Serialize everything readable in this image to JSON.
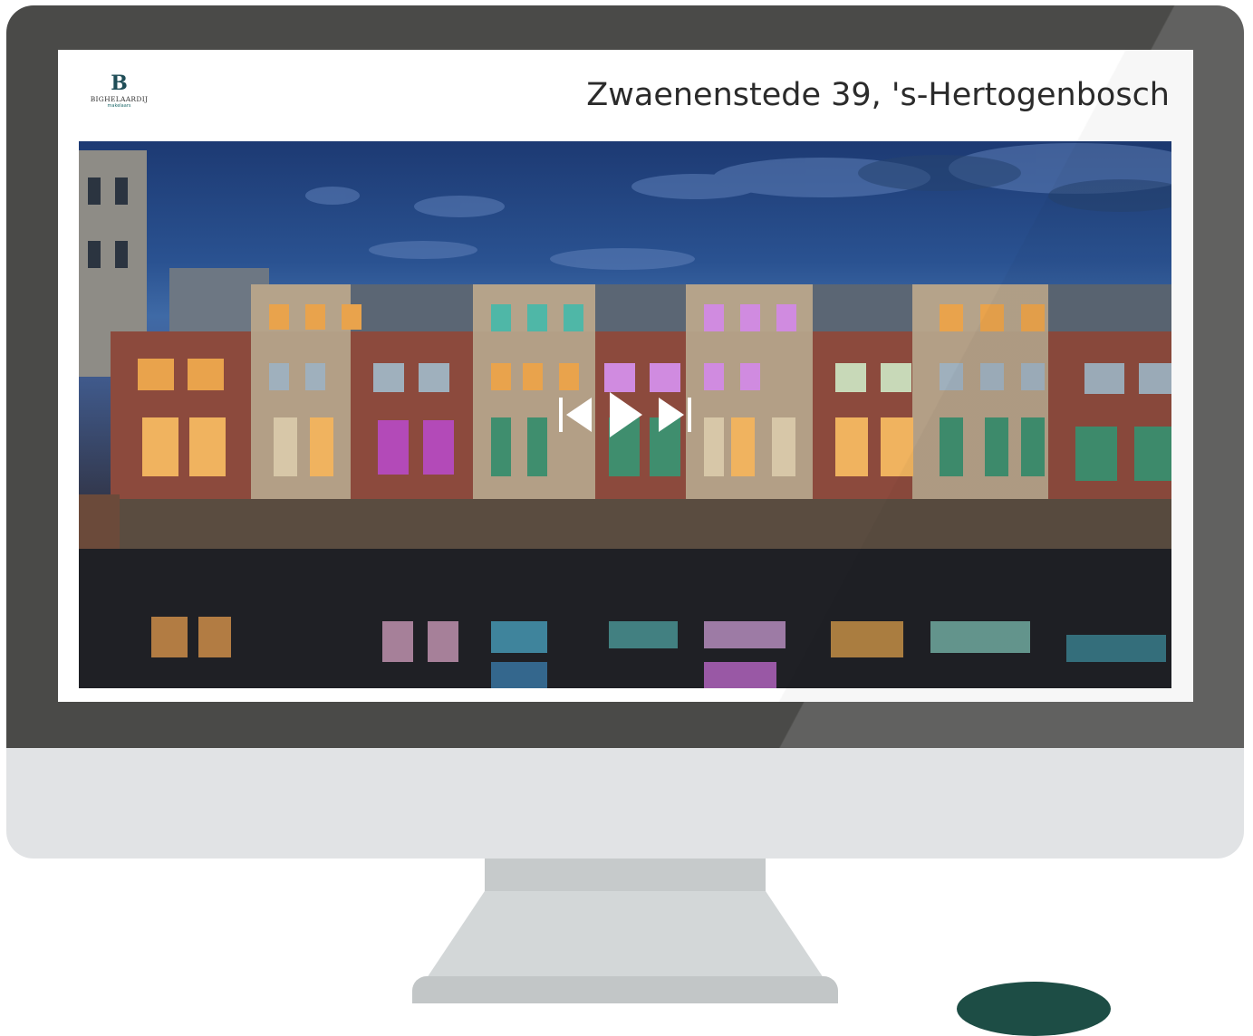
{
  "logo": {
    "letter": "B",
    "name": "BIGHELAARDIJ",
    "sub": "makelaars",
    "color": "#1f4d57"
  },
  "listing": {
    "title": "Zwaenenstede 39, 's-Hertogenbosch"
  },
  "player": {
    "controls": [
      "previous-icon",
      "play-icon",
      "next-icon"
    ]
  },
  "colors": {
    "bezel": "#4a4a48",
    "chin": "#e1e3e5",
    "stand": "#d3d7d8",
    "brand": "#1d4d45"
  }
}
